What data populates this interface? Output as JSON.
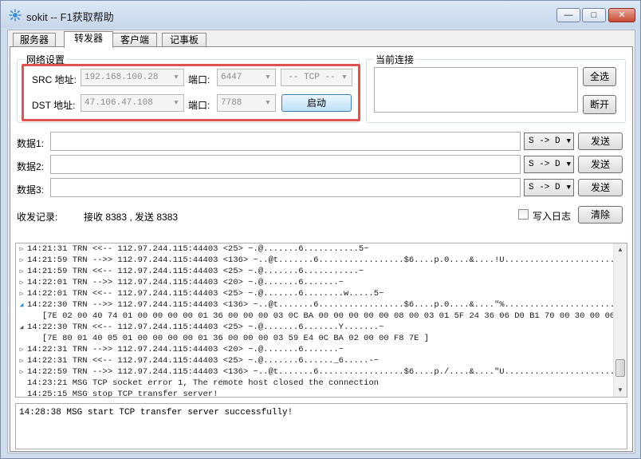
{
  "window": {
    "title": "sokit -- F1获取帮助",
    "min_label": "—",
    "max_label": "□",
    "close_label": "✕"
  },
  "tabs": [
    {
      "label": "服务器"
    },
    {
      "label": "转发器",
      "active": true
    },
    {
      "label": "客户端"
    },
    {
      "label": "记事板"
    }
  ],
  "network": {
    "legend": "网络设置",
    "src_label": "SRC 地址:",
    "src_address": "192.168.100.28",
    "src_port_label": "端口:",
    "src_port": "6447",
    "protocol": "-- TCP --",
    "dst_label": "DST 地址:",
    "dst_address": "47.106.47.108",
    "dst_port_label": "端口:",
    "dst_port": "7788",
    "start_button": "启动"
  },
  "connections": {
    "legend": "当前连接",
    "select_all_button": "全选",
    "disconnect_button": "断开"
  },
  "data_rows": [
    {
      "label": "数据1:",
      "direction": "S -> D",
      "send": "发送"
    },
    {
      "label": "数据2:",
      "direction": "S -> D",
      "send": "发送"
    },
    {
      "label": "数据3:",
      "direction": "S -> D",
      "send": "发送"
    }
  ],
  "records": {
    "label": "收发记录:",
    "stats": "接收 8383 , 发送 8383",
    "write_log_label": "写入日志",
    "write_log_checked": false,
    "clear_button": "清除"
  },
  "log": [
    {
      "marker": "closed",
      "text": "14:21:31 TRN <<-- 112.97.244.115:44403 <25> ~.@.......6...........5~"
    },
    {
      "marker": "closed",
      "text": "14:21:59 TRN -->> 112.97.244.115:44403 <136> ~..@t.......6.................$6....p.0....&....!U..........................…"
    },
    {
      "marker": "closed",
      "text": "14:21:59 TRN <<-- 112.97.244.115:44403 <25> ~.@.......6...........~"
    },
    {
      "marker": "closed",
      "text": "14:22:01 TRN -->> 112.97.244.115:44403 <20> ~.@.......6.......~"
    },
    {
      "marker": "closed",
      "text": "14:22:01 TRN <<-- 112.97.244.115:44403 <25> ~.@.......6........w.....5~"
    },
    {
      "marker": "open",
      "text": "14:22:30 TRN -->> 112.97.244.115:44403 <136> ~..@t.......6.................$6....p.0....&....\"%..........................…"
    },
    {
      "marker": "none",
      "text": "   [7E 02 00 40 74 01 00 00 00 00 01 36 00 00 00 03 0C BA 00 00 00 00 00 08 00 03 01 5F 24 36 06 D0 B1 70 00 30 00 00…"
    },
    {
      "marker": "open-dark",
      "text": "14:22:30 TRN <<-- 112.97.244.115:44403 <25> ~.@.......6.......Y.......~"
    },
    {
      "marker": "none",
      "text": "   [7E 80 01 40 05 01 00 00 00 00 01 36 00 00 00 03 59 E4 0C BA 02 00 00 F8 7E ]"
    },
    {
      "marker": "closed",
      "text": "14:22:31 TRN -->> 112.97.244.115:44403 <20> ~.@.......6.......~"
    },
    {
      "marker": "closed",
      "text": "14:22:31 TRN <<-- 112.97.244.115:44403 <25> ~.@.......6......_6.....-~"
    },
    {
      "marker": "closed",
      "text": "14:22:59 TRN -->> 112.97.244.115:44403 <136> ~..@t.......6.................$6....p./....&....\"U.........................…"
    },
    {
      "marker": "none",
      "text": "14:23:21 MSG TCP socket error 1, The remote host closed the connection"
    },
    {
      "marker": "none",
      "text": "14:25:15 MSG stop TCP transfer server!"
    }
  ],
  "status_message": "14:28:38 MSG start TCP transfer server successfully!"
}
